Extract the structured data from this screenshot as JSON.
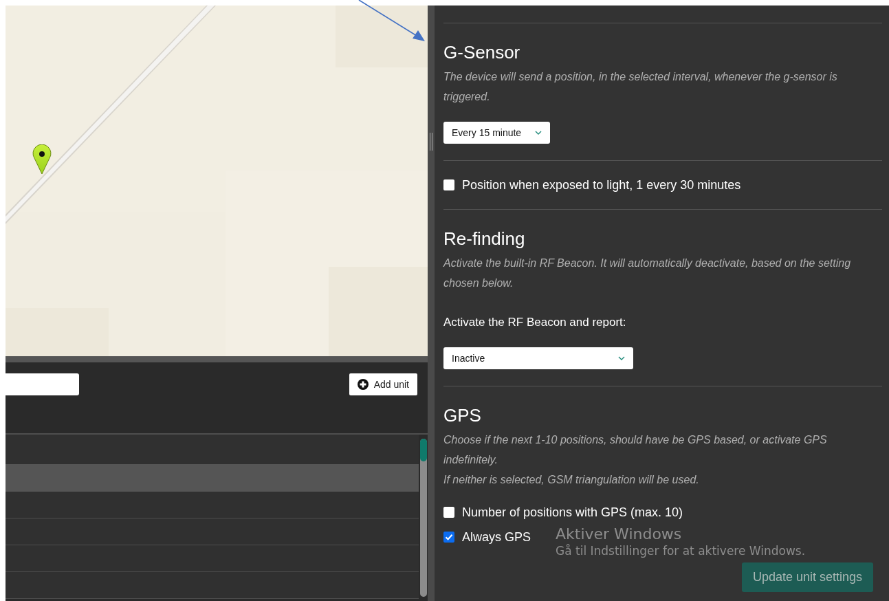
{
  "units_panel": {
    "add_button": "Add unit",
    "rows": [
      {
        "selected": false
      },
      {
        "selected": true
      },
      {
        "selected": false
      },
      {
        "selected": false
      },
      {
        "selected": false
      },
      {
        "selected": false
      }
    ]
  },
  "settings": {
    "sections": [
      {
        "kind": "select_section",
        "title": "G-Sensor",
        "description": [
          "The device will send a position, in the selected interval, whenever the g-sensor is triggered."
        ],
        "select": {
          "value": "Every 15 minute"
        }
      },
      {
        "kind": "checkbox",
        "label": "Position when exposed to light, 1 every 30 minutes",
        "checked": false
      },
      {
        "kind": "select_section",
        "title": "Re-finding",
        "description": [
          "Activate the built-in RF Beacon. It will automatically deactivate, based on the setting chosen below."
        ],
        "field_label": "Activate the RF Beacon and report:",
        "select": {
          "value": "Inactive"
        }
      },
      {
        "kind": "checkbox_section",
        "title": "GPS",
        "description": [
          "Choose if the next 1-10 positions, should have be GPS based, or activate GPS indefinitely.",
          "If neither is selected, GSM triangulation will be used."
        ],
        "options": [
          {
            "label": "Number of positions with GPS (max. 10)",
            "checked": false
          },
          {
            "label": "Always GPS",
            "checked": true
          }
        ]
      }
    ],
    "submit": "Update unit settings"
  },
  "os_watermark": {
    "title": "Aktiver Windows",
    "text": "Gå til Indstillinger for at aktivere Windows."
  }
}
